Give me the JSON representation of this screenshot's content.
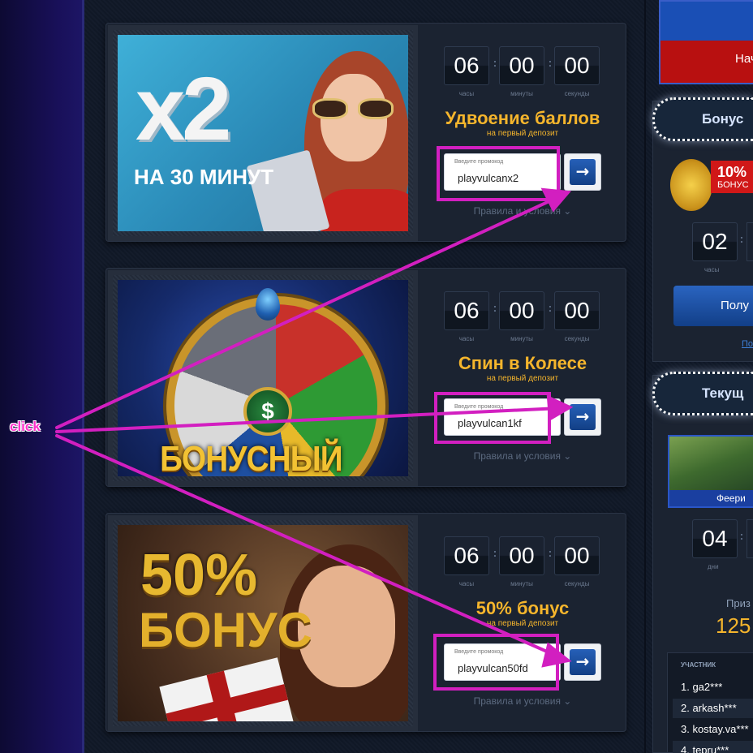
{
  "timer_labels": {
    "hours": "часы",
    "minutes": "минуты",
    "seconds": "секунды"
  },
  "code_hint": "Введите промокод",
  "rules_label": "Правила и условия ⌄",
  "go_button_icon": "arrow-right-icon",
  "promos": [
    {
      "image_big": "x2",
      "image_sub": "НА 30 МИНУТ",
      "timer": {
        "h": "06",
        "m": "00",
        "s": "00"
      },
      "title": "Удвоение баллов",
      "subtitle": "на первый депозит",
      "code": "playvulcanx2"
    },
    {
      "image_title": "БОНУСНЫЙ СПИН",
      "timer": {
        "h": "06",
        "m": "00",
        "s": "00"
      },
      "title": "Спин в Колесе",
      "subtitle": "на первый депозит",
      "code": "playvulcan1kf"
    },
    {
      "image_big": "50%",
      "image_sub": "БОНУС",
      "timer": {
        "h": "06",
        "m": "00",
        "s": "00"
      },
      "title": "50% бонус",
      "subtitle": "на первый депозит",
      "code": "playvulcan50fd"
    }
  ],
  "sidebar": {
    "top_button": "Нач",
    "bonus_header": "Бонус",
    "badge_pct": "10%",
    "badge_word": "БОНУС",
    "bonus_timer": "02",
    "bonus_timer_label": "часы",
    "get_button": "Полу",
    "link": "По",
    "current_header": "Текущ",
    "tournament_caption": "Феери",
    "tourn_timer": "04",
    "tourn_timer_label": "дни",
    "prize_label": "Приз",
    "prize_value": "125",
    "leader_header": "УЧАСТНИК",
    "leaders": [
      "1. ga2***",
      "2. arkash***",
      "3. kostay.va***",
      "4. tepru***"
    ]
  },
  "annotation": {
    "label": "click",
    "color": "#d21fc0"
  }
}
